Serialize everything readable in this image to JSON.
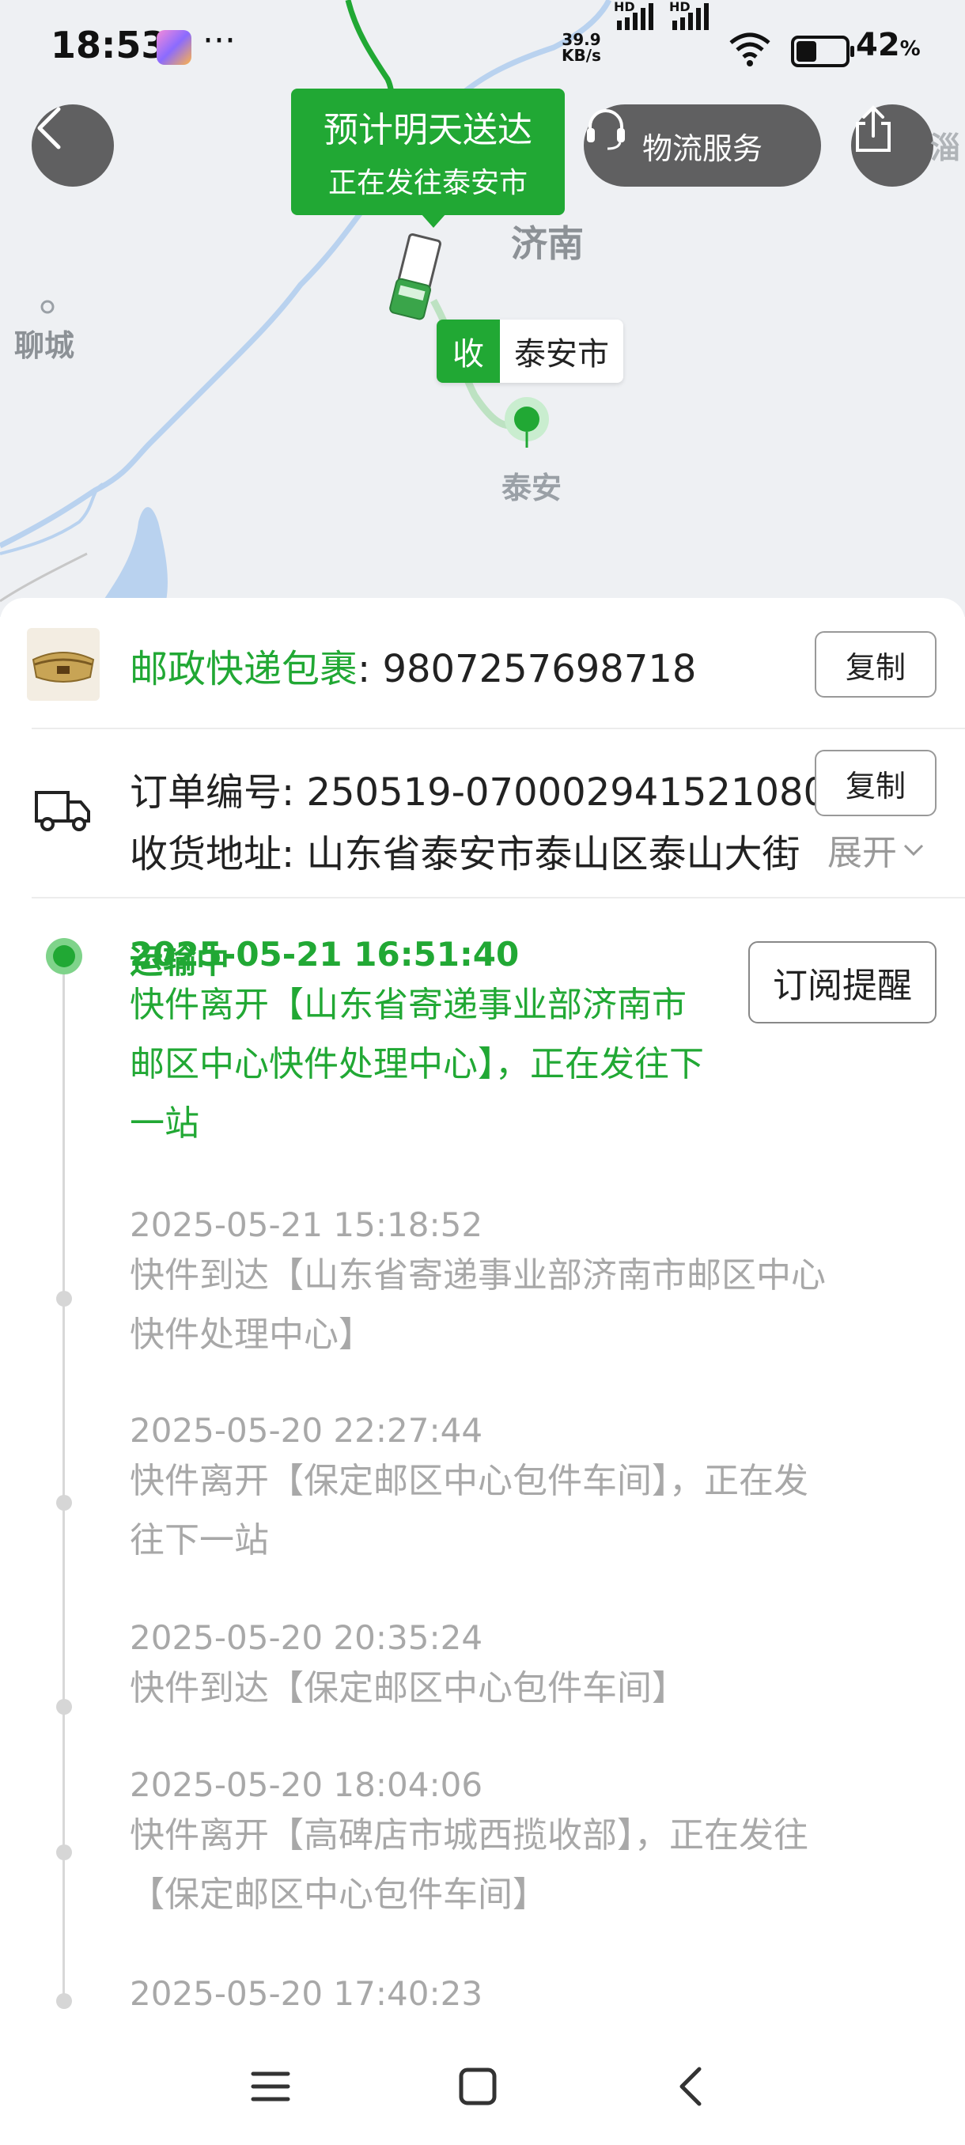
{
  "status_bar": {
    "time": "18:53",
    "more": "···",
    "net_speed_value": "39.9",
    "net_speed_unit": "KB/s",
    "hd1": "HD",
    "hd2": "HD",
    "battery": "42",
    "battery_unit": "%",
    "battery_level": 0.42
  },
  "map": {
    "eta_title": "预计明天送达",
    "eta_sub": "正在发往泰安市",
    "service_label": "物流服务",
    "city_jinan": "济南",
    "city_liaocheng": "聊城",
    "city_taian": "泰安",
    "city_zibo": "淄",
    "receiver_key": "收",
    "receiver_city": "泰安市"
  },
  "package": {
    "carrier": "邮政快递包裹",
    "tracking_no": ": 9807257698718",
    "copy_label": "复制"
  },
  "order": {
    "order_label": "订单编号",
    "order_no": ": 250519-070002941521080",
    "copy_label": "复制",
    "address_label": "收货地址",
    "address": ": 山东省泰安市泰山区泰山大街",
    "expand_label": "展开"
  },
  "timeline": {
    "subscribe_label": "订阅提醒",
    "events": [
      {
        "status": "运输中",
        "time": "2025-05-21 16:51:40",
        "desc": "快件离开【山东省寄递事业部济南市邮区中心快件处理中心】，正在发往下一站"
      },
      {
        "time": "2025-05-21 15:18:52",
        "desc": "快件到达【山东省寄递事业部济南市邮区中心快件处理中心】"
      },
      {
        "time": "2025-05-20 22:27:44",
        "desc": "快件离开【保定邮区中心包件车间】，正在发往下一站"
      },
      {
        "time": "2025-05-20 20:35:24",
        "desc": "快件到达【保定邮区中心包件车间】"
      },
      {
        "time": "2025-05-20 18:04:06",
        "desc": "快件离开【高碑店市城西揽收部】，正在发往【保定邮区中心包件车间】"
      },
      {
        "time": "2025-05-20 17:40:23",
        "desc": ""
      }
    ]
  },
  "colors": {
    "accent_green": "#21a834",
    "muted_text": "#a8a8a8",
    "map_bg": "#eef0f3",
    "river_blue": "#b8d3f2"
  },
  "icons": [
    "back-arrow-icon",
    "headset-icon",
    "share-icon",
    "truck-icon",
    "chevron-down-icon",
    "menu-icon",
    "home-square-icon",
    "back-chevron-icon"
  ]
}
